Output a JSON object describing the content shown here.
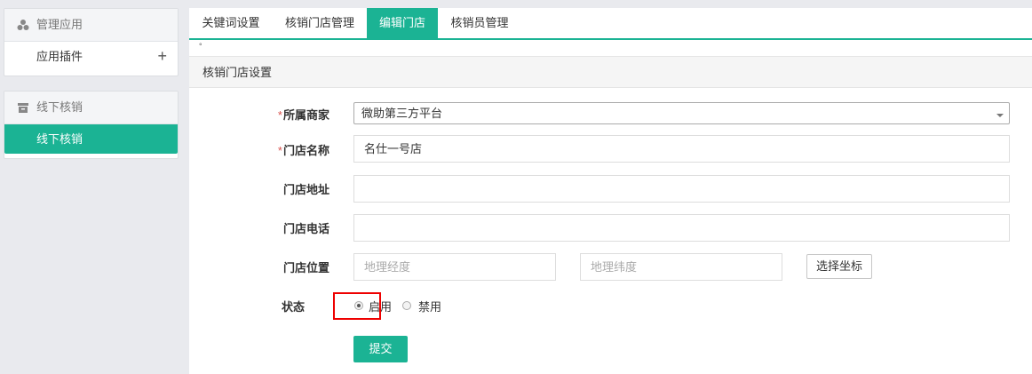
{
  "sidebar": {
    "groups": [
      {
        "title": "管理应用",
        "icon": "apps-icon",
        "items": [
          {
            "label": "应用插件",
            "action_icon": "+"
          }
        ]
      },
      {
        "title": "线下核销",
        "icon": "box-icon",
        "items": [
          {
            "label": "线下核销",
            "active": true
          }
        ]
      }
    ]
  },
  "tabs": [
    {
      "label": "关键词设置",
      "active": false
    },
    {
      "label": "核销门店管理",
      "active": false
    },
    {
      "label": "编辑门店",
      "active": true
    },
    {
      "label": "核销员管理",
      "active": false
    }
  ],
  "misc": {
    "dot": "°"
  },
  "section_title": "核销门店设置",
  "form": {
    "merchant": {
      "label": "所属商家",
      "required_mark": "*",
      "value": "微助第三方平台"
    },
    "store_name": {
      "label": "门店名称",
      "required_mark": "*",
      "value": "名仕一号店"
    },
    "address": {
      "label": "门店地址",
      "value": ""
    },
    "phone": {
      "label": "门店电话",
      "value": ""
    },
    "location": {
      "label": "门店位置",
      "longitude_placeholder": "地理经度",
      "latitude_placeholder": "地理纬度",
      "select_button": "选择坐标"
    },
    "status": {
      "label": "状态",
      "options": [
        {
          "label": "启用",
          "checked": true
        },
        {
          "label": "禁用",
          "checked": false
        }
      ]
    },
    "submit": "提交"
  },
  "colors": {
    "accent": "#1bb394",
    "highlight": "#e00000",
    "required": "#d9534f"
  }
}
